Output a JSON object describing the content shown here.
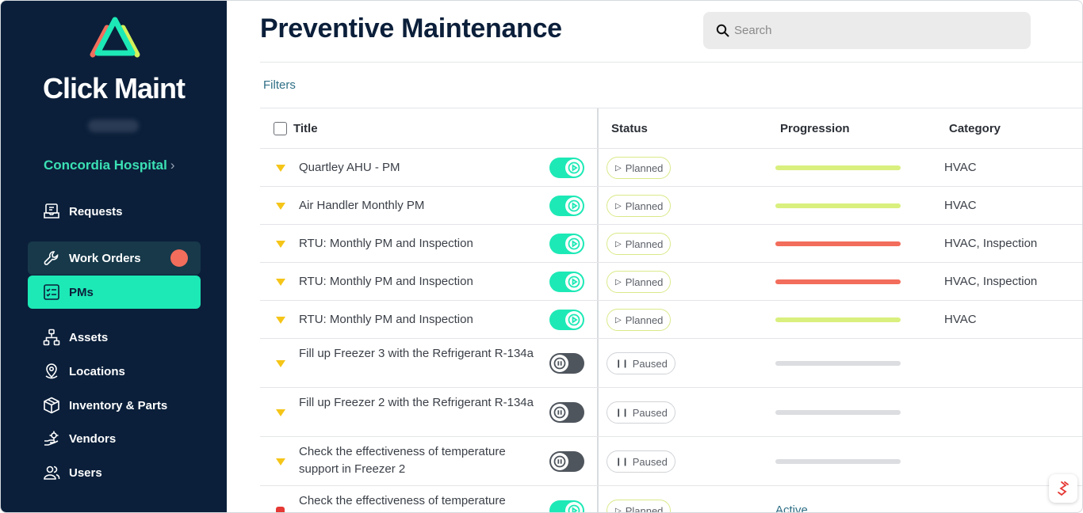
{
  "sidebar": {
    "brand": "Click Maint",
    "organization": "Concordia Hospital",
    "org_chevron": "›",
    "items": [
      {
        "label": "Requests",
        "icon": "requests-icon"
      },
      {
        "label": "Work Orders",
        "icon": "wrench-icon",
        "badge_color": "#f26d5b"
      },
      {
        "label": "PMs",
        "icon": "checklist-icon"
      },
      {
        "label": "Assets",
        "icon": "hierarchy-icon"
      },
      {
        "label": "Locations",
        "icon": "location-pin-icon"
      },
      {
        "label": "Inventory & Parts",
        "icon": "box-icon"
      },
      {
        "label": "Vendors",
        "icon": "vendor-gear-icon"
      },
      {
        "label": "Users",
        "icon": "users-icon"
      }
    ]
  },
  "header": {
    "title": "Preventive Maintenance",
    "search_placeholder": "Search",
    "filters_label": "Filters"
  },
  "table": {
    "columns": {
      "title": "Title",
      "status": "Status",
      "progression": "Progression",
      "category": "Category"
    },
    "rows": [
      {
        "priority": "medium",
        "title": "Quartley AHU - PM",
        "enabled": true,
        "status": "Planned",
        "progress": "green",
        "category": "HVAC"
      },
      {
        "priority": "medium",
        "title": "Air Handler Monthly PM",
        "enabled": true,
        "status": "Planned",
        "progress": "green",
        "category": "HVAC"
      },
      {
        "priority": "medium",
        "title": "RTU: Monthly PM and Inspection",
        "enabled": true,
        "status": "Planned",
        "progress": "red",
        "category": "HVAC, Inspection"
      },
      {
        "priority": "medium",
        "title": "RTU: Monthly PM and Inspection",
        "enabled": true,
        "status": "Planned",
        "progress": "red",
        "category": "HVAC, Inspection"
      },
      {
        "priority": "medium",
        "title": "RTU: Monthly PM and Inspection",
        "enabled": true,
        "status": "Planned",
        "progress": "green",
        "category": "HVAC"
      },
      {
        "priority": "medium",
        "title": "Fill up Freezer 3 with the Refrigerant R-134a",
        "enabled": false,
        "status": "Paused",
        "progress": "gray",
        "category": ""
      },
      {
        "priority": "medium",
        "title": "Fill up Freezer 2 with the Refrigerant R-134a",
        "enabled": false,
        "status": "Paused",
        "progress": "gray",
        "category": ""
      },
      {
        "priority": "medium",
        "title": "Check the effectiveness of temperature support in Freezer 2",
        "enabled": false,
        "status": "Paused",
        "progress": "gray",
        "category": ""
      },
      {
        "priority": "high",
        "title": "Check the effectiveness of temperature",
        "enabled": true,
        "status": "Planned",
        "progress_text": "Active",
        "category": ""
      }
    ]
  },
  "colors": {
    "sidebar_bg": "#0b1f3a",
    "accent": "#1de9b6",
    "progress_green": "#d9f07e",
    "progress_red": "#f26d5b",
    "priority_medium": "#f5c518",
    "priority_high": "#e53935"
  }
}
